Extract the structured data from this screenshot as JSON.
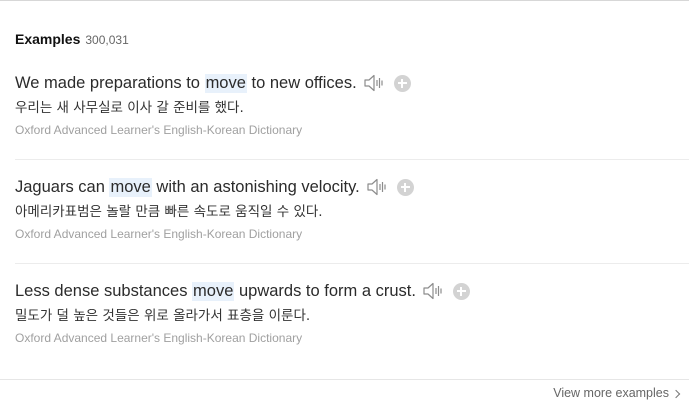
{
  "section": {
    "title": "Examples",
    "count": "300,031"
  },
  "examples": [
    {
      "before": "We made preparations to ",
      "keyword": "move",
      "after": " to new offices.",
      "translation": "우리는 새 사무실로 이사 갈 준비를 했다.",
      "source": "Oxford Advanced Learner's English-Korean Dictionary"
    },
    {
      "before": "Jaguars can ",
      "keyword": "move",
      "after": " with an astonishing velocity.",
      "translation": "아메리카표범은 놀랄 만큼 빠른 속도로 움직일 수 있다.",
      "source": "Oxford Advanced Learner's English-Korean Dictionary"
    },
    {
      "before": "Less dense substances ",
      "keyword": "move",
      "after": " upwards to form a crust.",
      "translation": "밀도가 덜 높은 것들은 위로 올라가서 표층을 이룬다.",
      "source": "Oxford Advanced Learner's English-Korean Dictionary"
    }
  ],
  "footer": {
    "view_more_label": "View more examples"
  },
  "icons": {
    "speaker": "speaker-icon",
    "add": "plus-circle-icon",
    "chevron": "chevron-right-icon"
  },
  "colors": {
    "keyword_highlight": "#e8f1fb",
    "source_text": "#a0a0a0",
    "add_button": "#d3d3d3"
  }
}
